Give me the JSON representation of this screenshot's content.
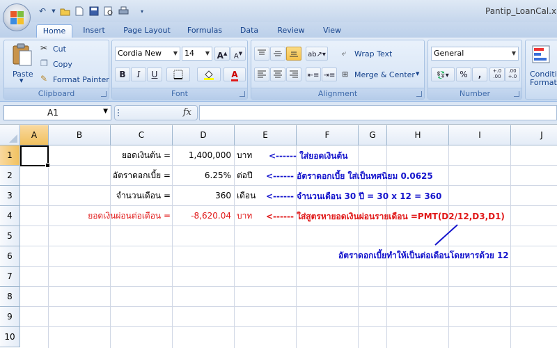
{
  "window": {
    "title": "Pantip_LoanCal.xlsx"
  },
  "tabs": [
    "Home",
    "Insert",
    "Page Layout",
    "Formulas",
    "Data",
    "Review",
    "View"
  ],
  "ribbon": {
    "clipboard": {
      "label": "Clipboard",
      "paste": "Paste",
      "cut": "Cut",
      "copy": "Copy",
      "format_painter": "Format Painter"
    },
    "font": {
      "label": "Font",
      "font_name": "Cordia New",
      "font_size": "14",
      "bold": "B",
      "italic": "I",
      "underline": "U",
      "grow": "A",
      "shrink": "A"
    },
    "alignment": {
      "label": "Alignment",
      "wrap_text": "Wrap Text",
      "merge_center": "Merge & Center"
    },
    "number": {
      "label": "Number",
      "format": "General",
      "percent": "%",
      "comma": ",",
      "inc_decimal": "+.0\n.00",
      "dec_decimal": ".00\n+.0"
    },
    "styles": {
      "conditional": "Conditi",
      "formatting": "Formatt"
    }
  },
  "formula_bar": {
    "name_box": "A1",
    "fx": "fx",
    "formula": ""
  },
  "columns": [
    "A",
    "B",
    "C",
    "D",
    "E",
    "F",
    "G",
    "H",
    "I",
    "J"
  ],
  "rows": [
    "1",
    "2",
    "3",
    "4",
    "5",
    "6",
    "7",
    "8",
    "9",
    "10"
  ],
  "cells": {
    "c1": "ยอดเงินต้น   =",
    "d1": "1,400,000",
    "e1": "บาท",
    "c2": "อัตราดอกเบี้ย   =",
    "d2": "6.25%",
    "e2": "ต่อปี",
    "c3": "จำนวนเดือน   =",
    "d3": "360",
    "e3": "เดือน",
    "c4": "ยอดเงินผ่อนต่อเดือน   =",
    "d4": "-8,620.04",
    "e4": "บาท"
  },
  "notes": {
    "n1": "<------  ใส่ยอดเงินต้น",
    "n2": "<------  อัตราดอกเบี้ย ใส่เป็นทศนิยม 0.0625",
    "n3": "<------  จำนวนเดือน 30 ปี = 30 x 12 = 360",
    "n4": "<------  ใส่สูตรหายอดเงินผ่อนรายเดือน   =PMT(D2/12,D3,D1)",
    "n5": "อัตราดอกเบี้ยทำให้เป็นต่อเดือนโดยหารด้วย 12"
  },
  "colors": {
    "note_blue": "#1414cc",
    "note_red": "#e01818",
    "accent": "#15428b"
  }
}
